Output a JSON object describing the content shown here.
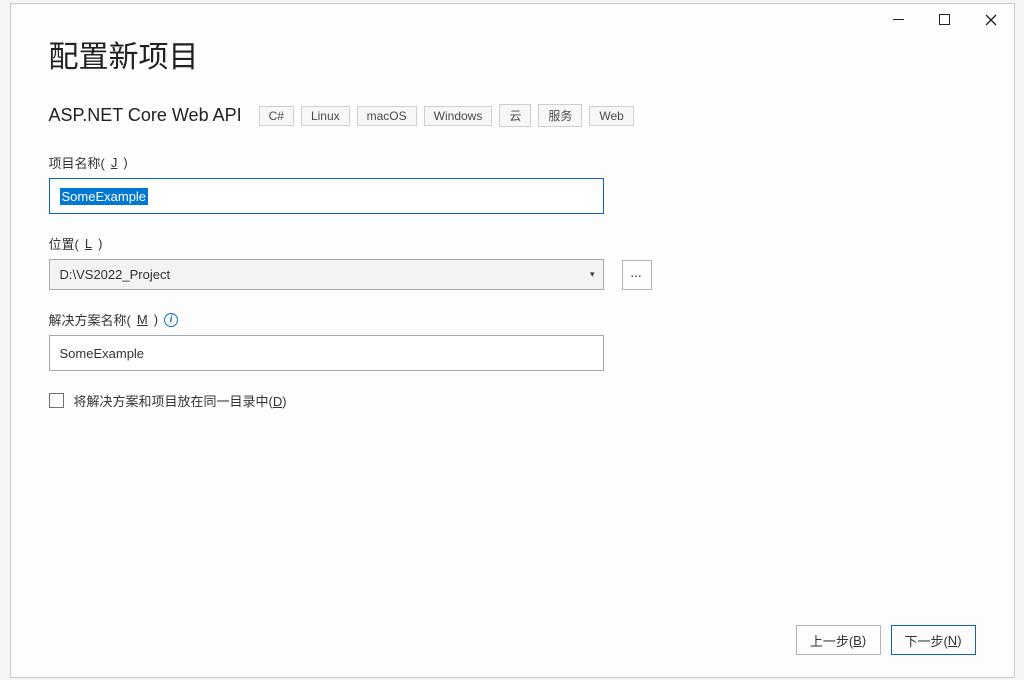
{
  "header": {
    "title": "配置新项目",
    "project_type": "ASP.NET Core Web API",
    "tags": [
      "C#",
      "Linux",
      "macOS",
      "Windows",
      "云",
      "服务",
      "Web"
    ]
  },
  "fields": {
    "project_name": {
      "label_prefix": "项目名称(",
      "accelerator": "J",
      "label_suffix": ")",
      "value": "SomeExample"
    },
    "location": {
      "label_prefix": "位置(",
      "accelerator": "L",
      "label_suffix": ")",
      "value": "D:\\VS2022_Project",
      "browse_text": "..."
    },
    "solution_name": {
      "label_prefix": "解决方案名称(",
      "accelerator": "M",
      "label_suffix": ")",
      "value": "SomeExample",
      "info_glyph": "i"
    },
    "same_dir_checkbox": {
      "label_prefix": "将解决方案和项目放在同一目录中(",
      "accelerator": "D",
      "label_suffix": ")",
      "checked": false
    }
  },
  "footer": {
    "back_prefix": "上一步(",
    "back_accel": "B",
    "back_suffix": ")",
    "next_prefix": "下一步(",
    "next_accel": "N",
    "next_suffix": ")"
  }
}
